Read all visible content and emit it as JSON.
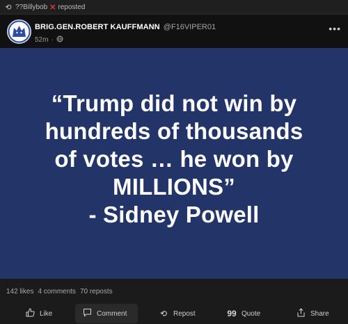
{
  "repost": {
    "icon": "repost-icon",
    "user": "??Billybob",
    "badge_icon": "x-mark-icon",
    "badge_char": "✕",
    "suffix": "reposted"
  },
  "post": {
    "author": {
      "display_name": "BRIG.GEN.ROBERT KAUFFMANN",
      "handle": "@F16VIPER01",
      "avatar": "wolf-logo-avatar"
    },
    "time": "52m",
    "meta_separator": "·",
    "visibility_icon": "globe-icon",
    "more_label": "•••"
  },
  "image": {
    "background": "#223468",
    "text_color": "#ffffff",
    "lines": [
      "“Trump did not win by",
      "hundreds of thousands",
      "of votes … he won by",
      "MILLIONS”",
      "- Sidney Powell"
    ]
  },
  "stats": {
    "likes": "142 likes",
    "comments": "4 comments",
    "reposts": "70 reposts"
  },
  "actions": [
    {
      "label": "Like",
      "icon": "thumbs-up-icon"
    },
    {
      "label": "Comment",
      "icon": "comment-icon"
    },
    {
      "label": "Repost",
      "icon": "repost-icon"
    },
    {
      "label": "Quote",
      "icon": "quote-icon"
    },
    {
      "label": "Share",
      "icon": "share-icon"
    }
  ]
}
